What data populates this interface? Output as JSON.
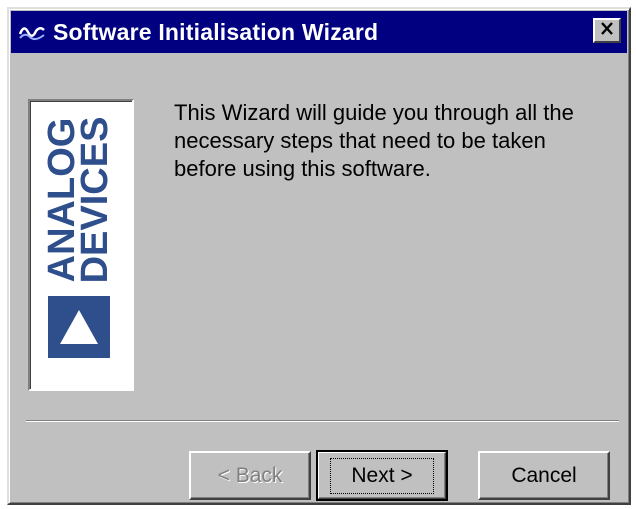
{
  "window": {
    "title": "Software Initialisation Wizard"
  },
  "logo": {
    "line1": "ANALOG",
    "line2": "DEVICES",
    "color": "#2e4e8c"
  },
  "message": "This Wizard will guide you through all the necessary steps that need to be taken before using this software.",
  "buttons": {
    "back": "< Back",
    "next": "Next >",
    "cancel": "Cancel"
  },
  "icons": {
    "app": "analog-waveform-icon",
    "close": "close-icon",
    "logo_mark": "triangle-logo-icon"
  },
  "colors": {
    "titlebar": "#000080",
    "face": "#c0c0c0"
  }
}
